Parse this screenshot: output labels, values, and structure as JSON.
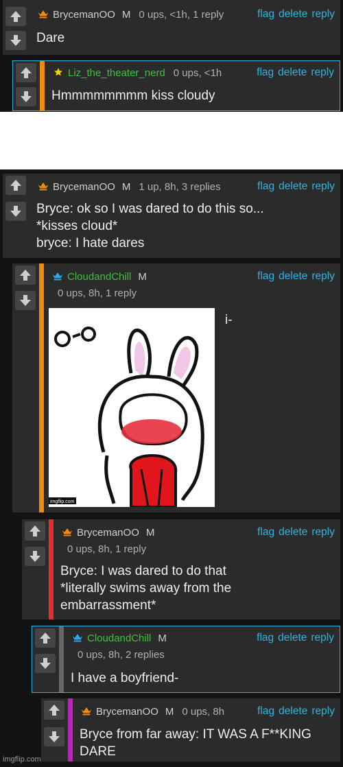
{
  "actions": {
    "flag": "flag",
    "delete": "delete",
    "reply": "reply"
  },
  "colors": {
    "link": "#2fb3e0",
    "bar_orange": "#f08a10",
    "bar_red": "#e03030",
    "bar_purple": "#c020c0",
    "card": "#2b2b2b"
  },
  "thread1": [
    {
      "user": "BrycemanOO",
      "mod": "M",
      "stats": "0 ups, <1h, 1 reply",
      "text": "Dare",
      "icon": "orange-crown-icon"
    },
    {
      "user": "Liz_the_theater_nerd",
      "stats": "0 ups, <1h",
      "text": "Hmmmmmmmm kiss cloudy",
      "icon": "yellow-star-icon"
    }
  ],
  "thread2": [
    {
      "user": "BrycemanOO",
      "mod": "M",
      "stats": "1 up, 8h, 3 replies",
      "text": "Bryce: ok so I was dared to do this so...\n*kisses cloud*\nbryce: I hate dares",
      "icon": "orange-crown-icon"
    },
    {
      "user": "CloudandChill",
      "mod": "M",
      "stats": "0 ups, 8h, 1 reply",
      "text": "i-",
      "icon": "blue-crown-icon",
      "image_caption": "imgflip.com"
    },
    {
      "user": "BrycemanOO",
      "mod": "M",
      "stats": "0 ups, 8h, 1 reply",
      "text": "Bryce: I was dared to do that\n*literally swims away from the\nembarrassment*",
      "icon": "orange-crown-icon"
    },
    {
      "user": "CloudandChill",
      "mod": "M",
      "stats": "0 ups, 8h, 2 replies",
      "text": "I have a boyfriend-",
      "icon": "blue-crown-icon"
    },
    {
      "user": "BrycemanOO",
      "mod": "M",
      "stats": "0 ups, 8h",
      "text": "Bryce from far away: IT WAS A F**KING\nDARE",
      "icon": "orange-crown-icon"
    }
  ],
  "footer": "imgflip.com"
}
